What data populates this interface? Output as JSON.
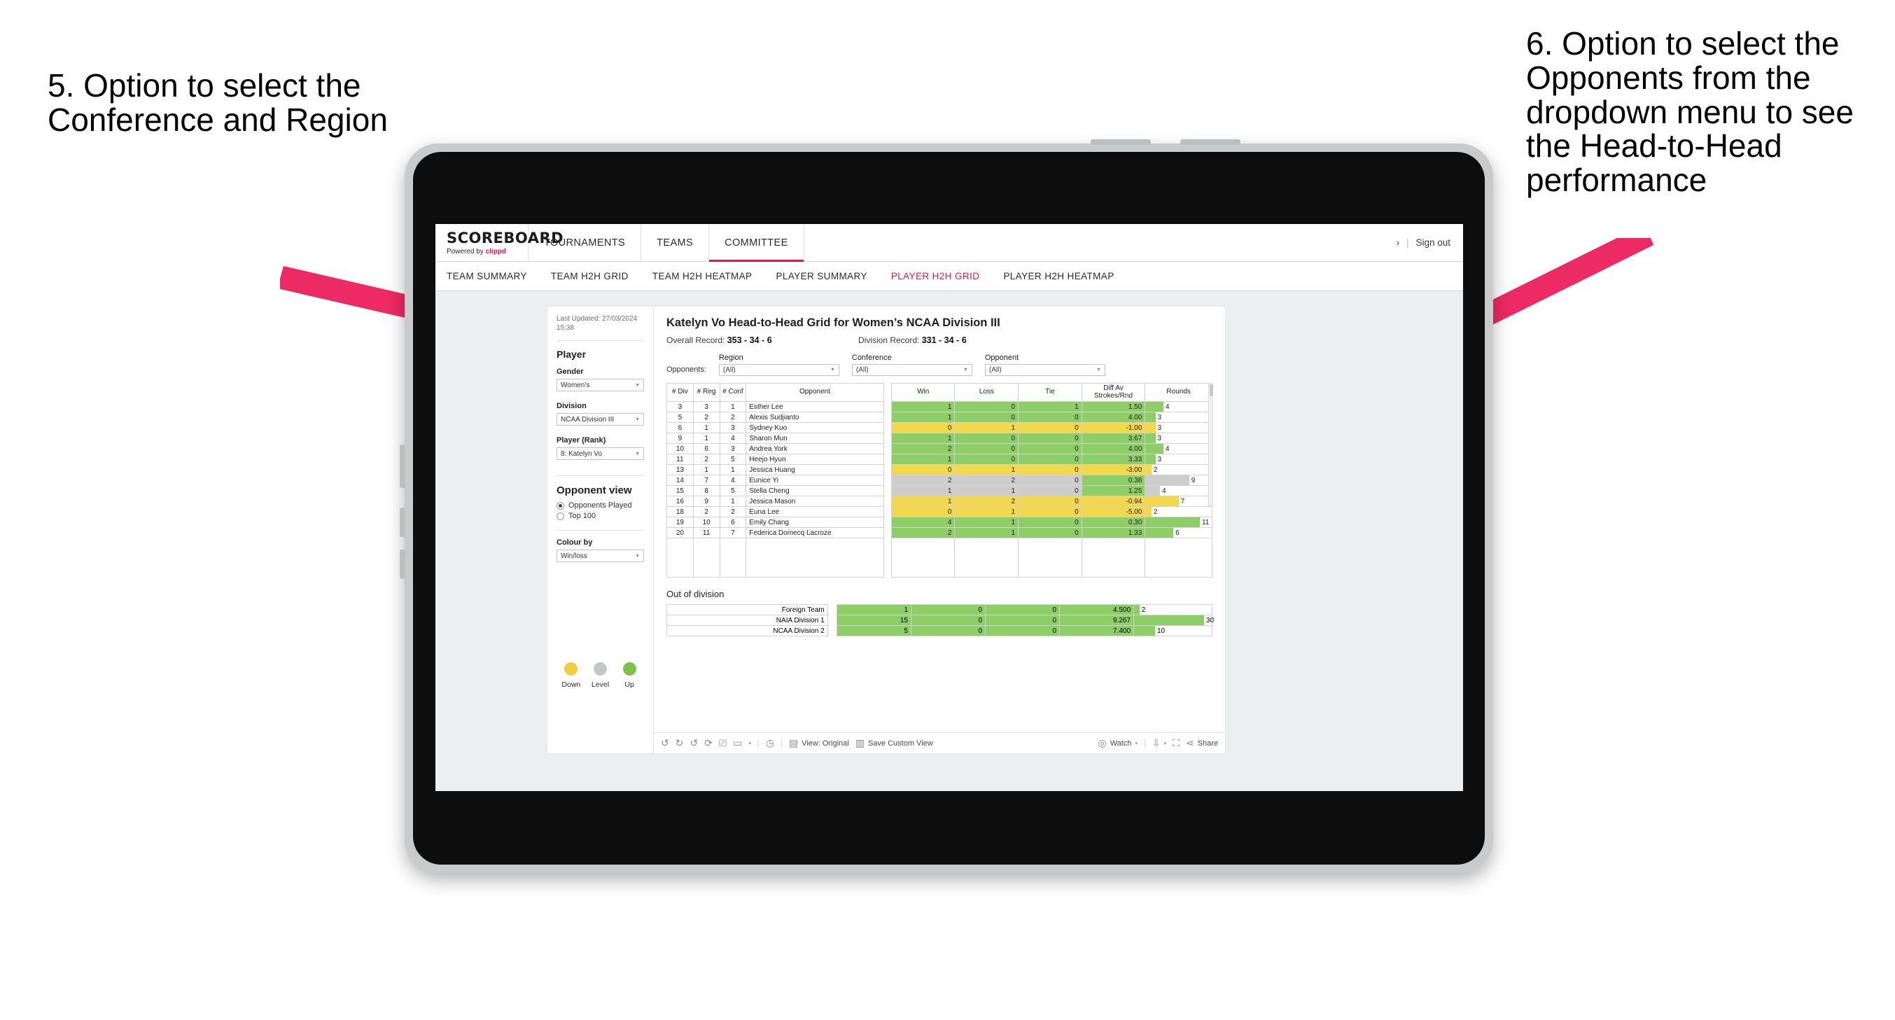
{
  "annotations": {
    "left": "5. Option to select the Conference and Region",
    "right": "6. Option to select the Opponents from the dropdown menu to see the Head-to-Head performance",
    "arrow_color": "#ED2A63"
  },
  "app": {
    "brand": {
      "name": "SCOREBOARD",
      "powered_prefix": "Powered by ",
      "powered_brand": "clippd"
    },
    "topnav": [
      {
        "label": "TOURNAMENTS",
        "active": false
      },
      {
        "label": "TEAMS",
        "active": false
      },
      {
        "label": "COMMITTEE",
        "active": true
      }
    ],
    "account": {
      "chevron": "›",
      "separator": "|",
      "sign_out": "Sign out"
    },
    "subnav": [
      {
        "label": "TEAM SUMMARY",
        "active": false
      },
      {
        "label": "TEAM H2H GRID",
        "active": false
      },
      {
        "label": "TEAM H2H HEATMAP",
        "active": false
      },
      {
        "label": "PLAYER SUMMARY",
        "active": false
      },
      {
        "label": "PLAYER H2H GRID",
        "active": true
      },
      {
        "label": "PLAYER H2H HEATMAP",
        "active": false
      }
    ],
    "accent_color": "#E8154A"
  },
  "sidebar": {
    "last_updated": "Last Updated: 27/03/2024 15:38",
    "player_heading": "Player",
    "gender": {
      "label": "Gender",
      "value": "Women’s"
    },
    "division": {
      "label": "Division",
      "value": "NCAA Division III"
    },
    "player_rank": {
      "label": "Player (Rank)",
      "value": "8. Katelyn Vo"
    },
    "opponent_view": {
      "heading": "Opponent view",
      "options": [
        {
          "label": "Opponents Played",
          "selected": true
        },
        {
          "label": "Top 100",
          "selected": false
        }
      ]
    },
    "colour_by": {
      "label": "Colour by",
      "value": "Win/loss"
    },
    "legend": [
      {
        "label": "Down",
        "color": "#F2CE3E"
      },
      {
        "label": "Level",
        "color": "#C4C6C8"
      },
      {
        "label": "Up",
        "color": "#7DC24B"
      }
    ]
  },
  "main": {
    "title": "Katelyn Vo Head-to-Head Grid for Women’s NCAA Division III",
    "overall_record": {
      "label": "Overall Record:",
      "value": "353 - 34 - 6"
    },
    "division_record": {
      "label": "Division Record:",
      "value": "331 - 34 - 6"
    },
    "filters": {
      "prefix_label": "Opponents:",
      "items": [
        {
          "label": "Region",
          "value": "(All)"
        },
        {
          "label": "Conference",
          "value": "(All)"
        },
        {
          "label": "Opponent",
          "value": "(All)"
        }
      ]
    },
    "table": {
      "headers": {
        "div": "# Div",
        "reg": "# Reg",
        "conf": "# Conf",
        "opponent": "Opponent",
        "win": "Win",
        "loss": "Loss",
        "tie": "Tie",
        "diff": "Diff Av Strokes/Rnd",
        "rounds": "Rounds"
      },
      "rows": [
        {
          "div": "3",
          "reg": "3",
          "conf": "1",
          "opponent": "Esther Lee",
          "win": "1",
          "loss": "0",
          "tie": "1",
          "diff": "1.50",
          "rounds": "4",
          "color": "#8DCE67",
          "bar_pct": 27
        },
        {
          "div": "5",
          "reg": "2",
          "conf": "2",
          "opponent": "Alexis Sudjianto",
          "win": "1",
          "loss": "0",
          "tie": "0",
          "diff": "4.00",
          "rounds": "3",
          "color": "#8DCE67",
          "bar_pct": 15
        },
        {
          "div": "6",
          "reg": "1",
          "conf": "3",
          "opponent": "Sydney Kuo",
          "win": "0",
          "loss": "1",
          "tie": "0",
          "diff": "-1.00",
          "rounds": "3",
          "color": "#F3D84E",
          "bar_pct": 15
        },
        {
          "div": "9",
          "reg": "1",
          "conf": "4",
          "opponent": "Sharon Mun",
          "win": "1",
          "loss": "0",
          "tie": "0",
          "diff": "3.67",
          "rounds": "3",
          "color": "#8DCE67",
          "bar_pct": 15
        },
        {
          "div": "10",
          "reg": "6",
          "conf": "3",
          "opponent": "Andrea York",
          "win": "2",
          "loss": "0",
          "tie": "0",
          "diff": "4.00",
          "rounds": "4",
          "color": "#8DCE67",
          "bar_pct": 27
        },
        {
          "div": "11",
          "reg": "2",
          "conf": "5",
          "opponent": "Heejo Hyun",
          "win": "1",
          "loss": "0",
          "tie": "0",
          "diff": "3.33",
          "rounds": "3",
          "color": "#8DCE67",
          "bar_pct": 15
        },
        {
          "div": "13",
          "reg": "1",
          "conf": "1",
          "opponent": "Jessica Huang",
          "win": "0",
          "loss": "1",
          "tie": "0",
          "diff": "-3.00",
          "rounds": "2",
          "color": "#F3D84E",
          "bar_pct": 9
        },
        {
          "div": "14",
          "reg": "7",
          "conf": "4",
          "opponent": "Eunice Yi",
          "win": "2",
          "loss": "2",
          "tie": "0",
          "diff": "0.38",
          "rounds": "9",
          "color": "#CDCDCD",
          "diff_color": "#8DCE67",
          "bar_pct": 66
        },
        {
          "div": "15",
          "reg": "8",
          "conf": "5",
          "opponent": "Stella Cheng",
          "win": "1",
          "loss": "1",
          "tie": "0",
          "diff": "1.25",
          "rounds": "4",
          "color": "#CDCDCD",
          "diff_color": "#8DCE67",
          "bar_pct": 22
        },
        {
          "div": "16",
          "reg": "9",
          "conf": "1",
          "opponent": "Jessica Mason",
          "win": "1",
          "loss": "2",
          "tie": "0",
          "diff": "-0.94",
          "rounds": "7",
          "color": "#F3D84E",
          "bar_pct": 50
        },
        {
          "div": "18",
          "reg": "2",
          "conf": "2",
          "opponent": "Euna Lee",
          "win": "0",
          "loss": "1",
          "tie": "0",
          "diff": "-5.00",
          "rounds": "2",
          "color": "#F3D84E",
          "bar_pct": 9
        },
        {
          "div": "19",
          "reg": "10",
          "conf": "6",
          "opponent": "Emily Chang",
          "win": "4",
          "loss": "1",
          "tie": "0",
          "diff": "0.30",
          "rounds": "11",
          "color": "#8DCE67",
          "bar_pct": 82
        },
        {
          "div": "20",
          "reg": "11",
          "conf": "7",
          "opponent": "Federica Domecq Lacroze",
          "win": "2",
          "loss": "1",
          "tie": "0",
          "diff": "1.33",
          "rounds": "6",
          "color": "#8DCE67",
          "bar_pct": 42
        }
      ]
    },
    "out_of_division": {
      "title": "Out of division",
      "rows": [
        {
          "label": "Foreign Team",
          "win": "1",
          "loss": "0",
          "tie": "0",
          "diff": "4.500",
          "rounds": "2",
          "color": "#8DCE67",
          "bar_pct": 7
        },
        {
          "label": "NAIA Division 1",
          "win": "15",
          "loss": "0",
          "tie": "0",
          "diff": "9.267",
          "rounds": "30",
          "color": "#8DCE67",
          "bar_pct": 90
        },
        {
          "label": "NCAA Division 2",
          "win": "5",
          "loss": "0",
          "tie": "0",
          "diff": "7.400",
          "rounds": "10",
          "color": "#8DCE67",
          "bar_pct": 27
        }
      ]
    }
  },
  "toolbar": {
    "view_label": "View: Original",
    "save_label": "Save Custom View",
    "watch_label": "Watch",
    "share_label": "Share",
    "caret": "▾"
  }
}
